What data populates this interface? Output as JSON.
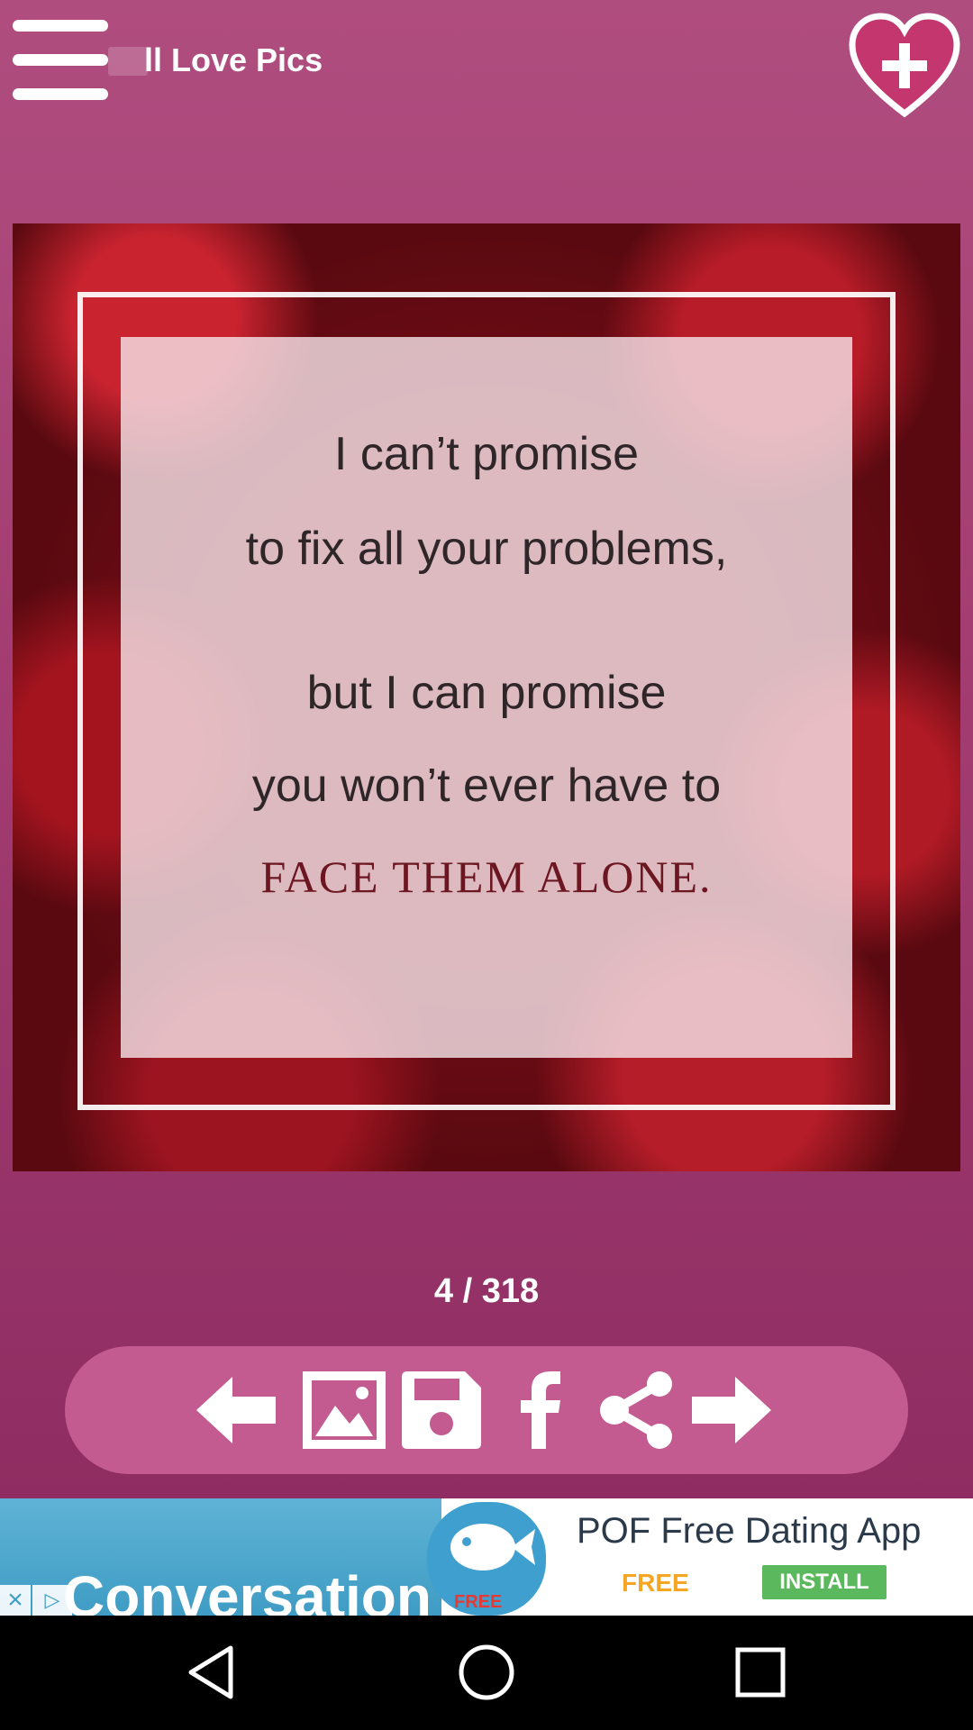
{
  "header": {
    "title": "ll Love Pics",
    "menu_icon": "hamburger-menu-icon",
    "favorite_icon": "heart-plus-icon"
  },
  "quote": {
    "line1": "I can’t promise",
    "line2": "to fix all your problems,",
    "line3": "but I can promise",
    "line4": "you won’t ever have to",
    "line5": "FACE THEM ALONE."
  },
  "counter": "4 / 318",
  "toolbar": {
    "icons": [
      "arrow-left-icon",
      "image-icon",
      "save-icon",
      "facebook-icon",
      "share-icon",
      "arrow-right-icon"
    ]
  },
  "ad": {
    "left_text": "Conversation",
    "title": "POF Free Dating App",
    "free_label": "FREE",
    "logo_tag": "FREE",
    "install_label": "INSTALL",
    "close_icon": "close-icon",
    "adchoices_icon": "adchoices-icon"
  },
  "navbar": {
    "icons": [
      "back-icon",
      "home-icon",
      "recents-icon"
    ]
  },
  "colors": {
    "background": "#a33d71",
    "toolbar": "#c35b91",
    "quote_emphasis": "#6b1620"
  }
}
